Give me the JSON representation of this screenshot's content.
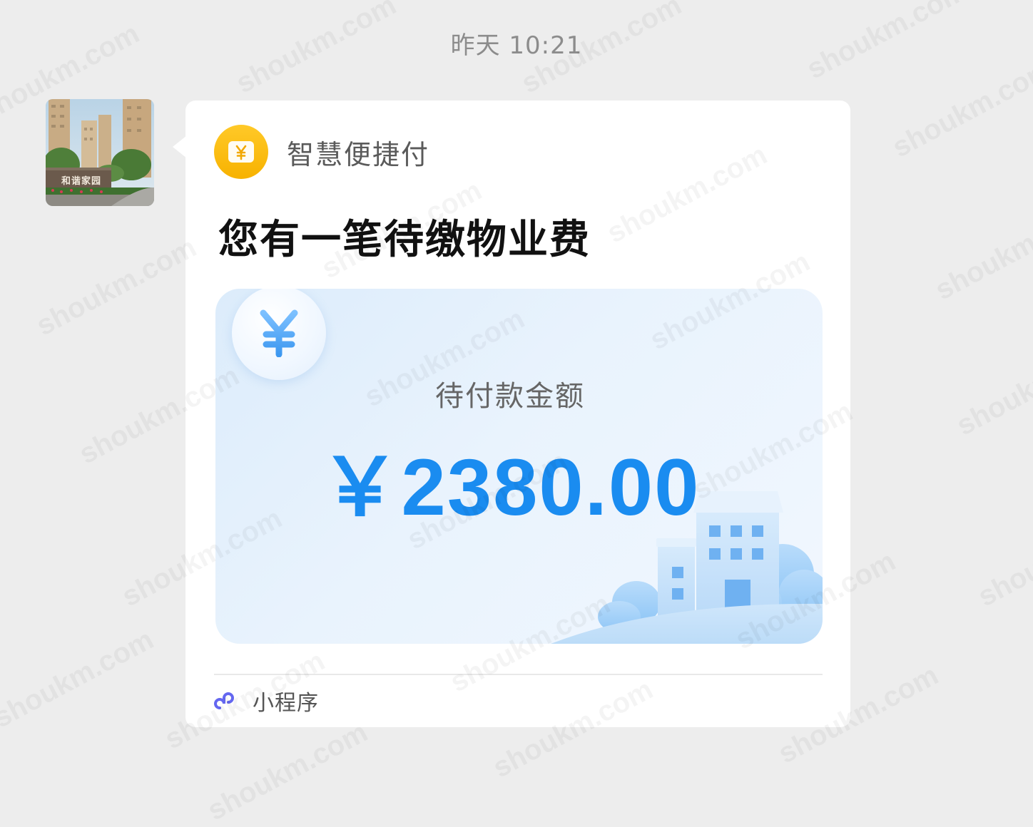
{
  "chat": {
    "timestamp": "昨天 10:21"
  },
  "avatar": {
    "sign_text": "和谐家园"
  },
  "card": {
    "brand_name": "智慧便捷付",
    "brand_icon": "yen-wallet-icon",
    "title": "您有一笔待缴物业费",
    "panel": {
      "label": "待付款金额",
      "amount": "￥2380.00"
    },
    "footer": {
      "label": "小程序",
      "icon": "mini-program-icon"
    }
  },
  "watermark": "shoukm.com",
  "colors": {
    "background": "#ededed",
    "amount": "#1a8cf0",
    "brand_yellow": "#f7b200",
    "mini_program_icon": "#6467f0"
  }
}
